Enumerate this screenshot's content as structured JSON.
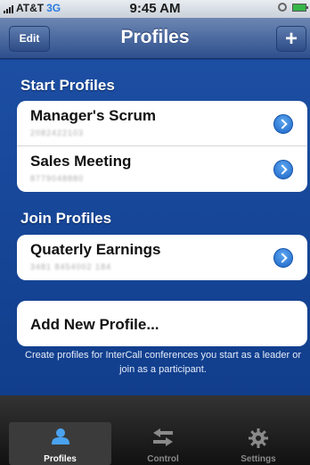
{
  "status_bar": {
    "carrier": "AT&T",
    "network": "3G",
    "time": "9:45 AM",
    "signal_bars": 4,
    "battery": "full"
  },
  "nav": {
    "title": "Profiles",
    "edit_label": "Edit",
    "add_label": "+"
  },
  "sections": {
    "start": {
      "header": "Start Profiles",
      "items": [
        {
          "title": "Manager's Scrum",
          "detail": "2082422103"
        },
        {
          "title": "Sales Meeting",
          "detail": "8779048880"
        }
      ]
    },
    "join": {
      "header": "Join Profiles",
      "items": [
        {
          "title": "Quaterly Earnings",
          "detail": "3481 8454002 184"
        }
      ]
    }
  },
  "add_profile_label": "Add New Profile...",
  "footer_note": "Create profiles for InterCall conferences you start as a leader or join as a participant.",
  "tabs": [
    {
      "label": "Profiles",
      "icon": "person-icon",
      "selected": true
    },
    {
      "label": "Control",
      "icon": "arrows-icon",
      "selected": false
    },
    {
      "label": "Settings",
      "icon": "gear-icon",
      "selected": false
    }
  ],
  "colors": {
    "background": "#1c4ea3",
    "nav_bar": "#3d5e98",
    "disclosure": "#2a7ad8",
    "tab_bar": "#1a1a1a"
  }
}
